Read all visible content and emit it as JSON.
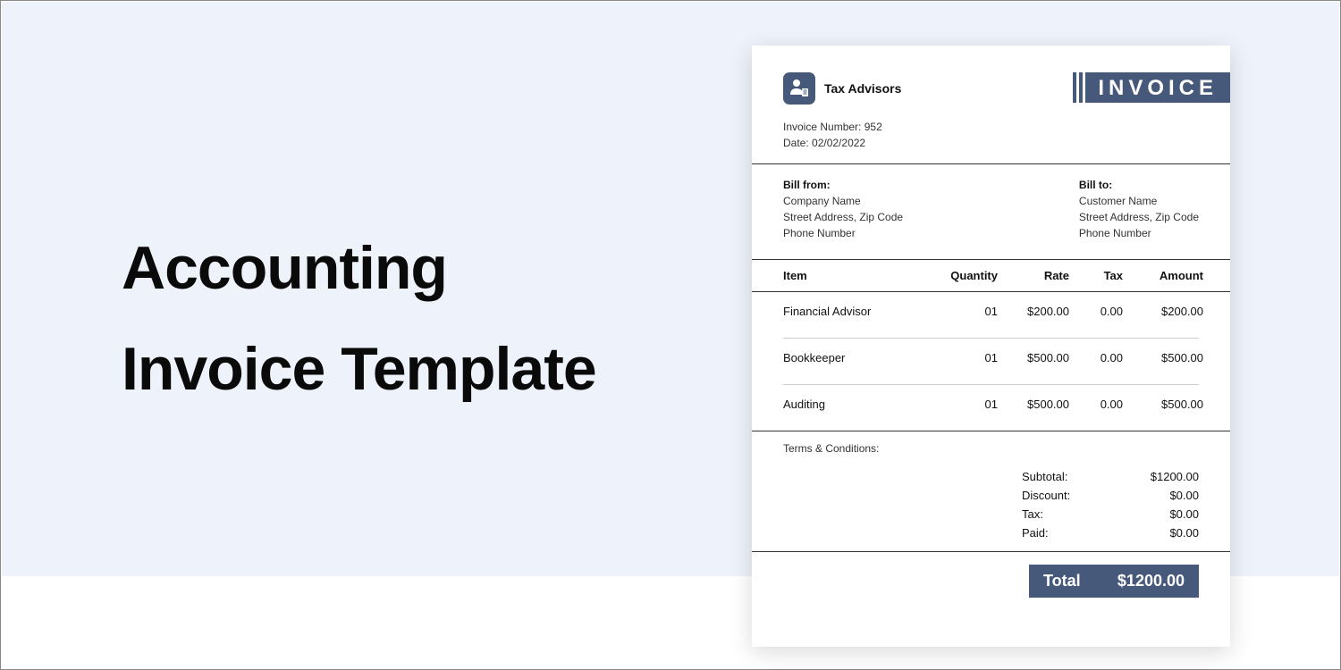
{
  "heading": {
    "line1": "Accounting",
    "line2": "Invoice Template"
  },
  "brand": {
    "name": "Tax Advisors",
    "icon": "advisor-icon"
  },
  "banner": "INVOICE",
  "meta": {
    "invoice_number_label": "Invoice Number:",
    "invoice_number": "952",
    "date_label": "Date:",
    "date": "02/02/2022"
  },
  "bill_from": {
    "label": "Bill from:",
    "name": "Company Name",
    "address": "Street Address, Zip Code",
    "phone": "Phone Number"
  },
  "bill_to": {
    "label": "Bill to:",
    "name": "Customer Name",
    "address": "Street Address, Zip Code",
    "phone": "Phone Number"
  },
  "columns": {
    "item": "Item",
    "quantity": "Quantity",
    "rate": "Rate",
    "tax": "Tax",
    "amount": "Amount"
  },
  "rows": [
    {
      "item": "Financial Advisor",
      "quantity": "01",
      "rate": "$200.00",
      "tax": "0.00",
      "amount": "$200.00"
    },
    {
      "item": "Bookkeeper",
      "quantity": "01",
      "rate": "$500.00",
      "tax": "0.00",
      "amount": "$500.00"
    },
    {
      "item": "Auditing",
      "quantity": "01",
      "rate": "$500.00",
      "tax": "0.00",
      "amount": "$500.00"
    }
  ],
  "terms_label": "Terms & Conditions:",
  "totals": {
    "subtotal_label": "Subtotal:",
    "subtotal": "$1200.00",
    "discount_label": "Discount:",
    "discount": "$0.00",
    "tax_label": "Tax:",
    "tax": "$0.00",
    "paid_label": "Paid:",
    "paid": "$0.00",
    "total_label": "Total",
    "total": "$1200.00"
  },
  "colors": {
    "accent": "#46597a",
    "tint": "#edf2fb"
  }
}
